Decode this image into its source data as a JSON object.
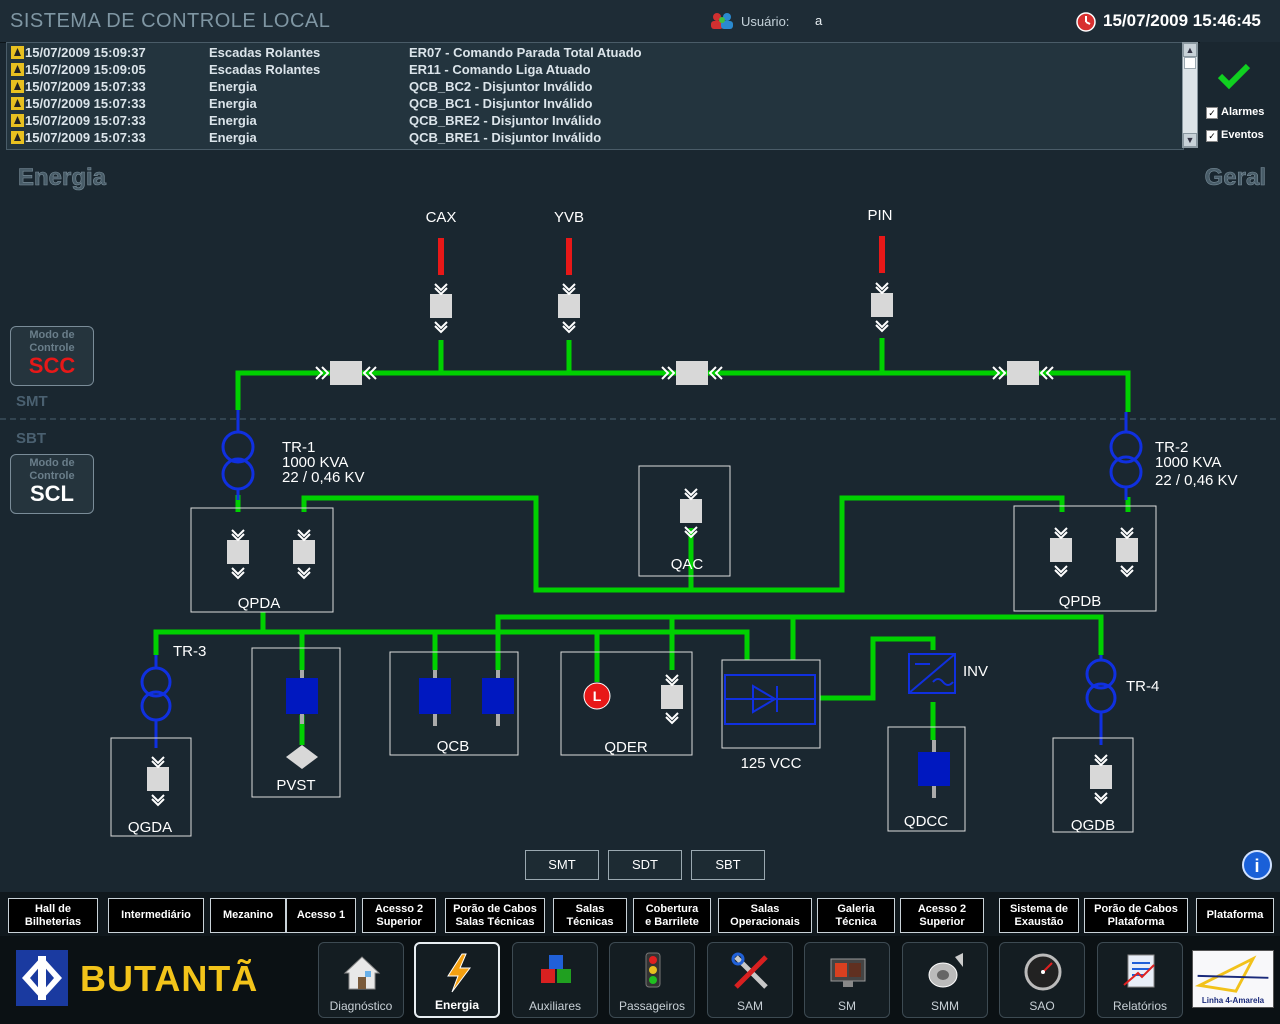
{
  "header": {
    "system_title": "SISTEMA DE CONTROLE LOCAL",
    "user_label": "Usuário:",
    "user_value": "a",
    "datetime": "15/07/2009 15:46:45"
  },
  "alarms": [
    {
      "timestamp": "15/07/2009 15:09:37",
      "system": "Escadas Rolantes",
      "message": "ER07 - Comando Parada Total Atuado"
    },
    {
      "timestamp": "15/07/2009 15:09:05",
      "system": "Escadas Rolantes",
      "message": "ER11 - Comando Liga Atuado"
    },
    {
      "timestamp": "15/07/2009 15:07:33",
      "system": "Energia",
      "message": "QCB_BC2 - Disjuntor Inválido"
    },
    {
      "timestamp": "15/07/2009 15:07:33",
      "system": "Energia",
      "message": "QCB_BC1 - Disjuntor Inválido"
    },
    {
      "timestamp": "15/07/2009 15:07:33",
      "system": "Energia",
      "message": "QCB_BRE2 - Disjuntor Inválido"
    },
    {
      "timestamp": "15/07/2009 15:07:33",
      "system": "Energia",
      "message": "QCB_BRE1 - Disjuntor Inválido"
    }
  ],
  "filters": {
    "alarms_label": "Alarmes",
    "alarms_checked": true,
    "events_label": "Eventos",
    "events_checked": true
  },
  "screen": {
    "left_title": "Energia",
    "right_title": "Geral"
  },
  "control_mode": {
    "label": "Modo de Controle",
    "scc": "SCC",
    "scl": "SCL",
    "smt_label": "SMT",
    "sbt_label": "SBT",
    "scc_color": "#e81818",
    "scl_color": "#ffffff"
  },
  "diagram": {
    "feeders": [
      "CAX",
      "YVB",
      "PIN"
    ],
    "tr1": {
      "name": "TR-1",
      "power": "1000 KVA",
      "voltage": "22 / 0,46 KV"
    },
    "tr2": {
      "name": "TR-2",
      "power": "1000 KVA",
      "voltage": "22 / 0,46 KV"
    },
    "tr3": "TR-3",
    "tr4": "TR-4",
    "panels": {
      "qpda": "QPDA",
      "qac": "QAC",
      "qpdb": "QPDB",
      "qgda": "QGDA",
      "pvst": "PVST",
      "qcb": "QCB",
      "qder": "QDER",
      "vcc": "125 VCC",
      "inv": "INV",
      "qdcc": "QDCC",
      "qgdb": "QGDB"
    },
    "qder_marker": "L",
    "colors": {
      "energized": "#00d000",
      "feeder": "#e81818",
      "transformer": "#1030e0",
      "breaker": "#d8d8d8",
      "dc_breaker": "#0018c0"
    }
  },
  "level_buttons": [
    "SMT",
    "SDT",
    "SBT"
  ],
  "nav_areas": [
    "Hall de\nBilheterias",
    "Intermediário",
    "Mezanino",
    "Acesso 1",
    "Acesso 2\nSuperior",
    "Porão de Cabos\nSalas Técnicas",
    "Salas\nTécnicas",
    "Cobertura\ne Barrilete",
    "Salas\nOperacionais",
    "Galeria\nTécnica",
    "Acesso 2\nSuperior",
    "Sistema de\nExaustão",
    "Porão de Cabos\nPlataforma",
    "Plataforma"
  ],
  "station_name": "BUTANTÃ",
  "toolbar": [
    {
      "label": "Diagnóstico",
      "icon": "house-icon"
    },
    {
      "label": "Energia",
      "icon": "lightning-icon",
      "active": true
    },
    {
      "label": "Auxiliares",
      "icon": "cubes-icon"
    },
    {
      "label": "Passageiros",
      "icon": "traffic-light-icon"
    },
    {
      "label": "SAM",
      "icon": "tools-icon"
    },
    {
      "label": "SM",
      "icon": "monitor-icon"
    },
    {
      "label": "SMM",
      "icon": "speaker-icon"
    },
    {
      "label": "SAO",
      "icon": "gauge-icon"
    },
    {
      "label": "Relatórios",
      "icon": "report-icon"
    }
  ],
  "line_logo_label": "Linha 4-Amarela"
}
